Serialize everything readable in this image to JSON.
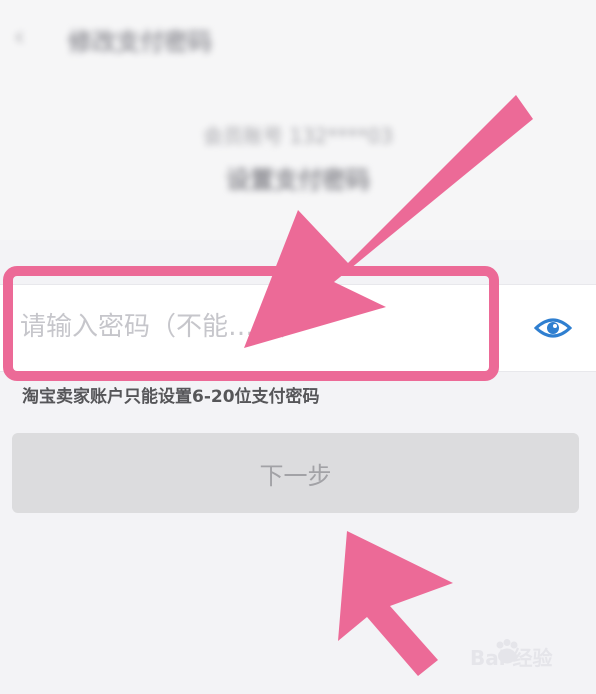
{
  "header": {
    "back_icon": "chevron-left-icon",
    "title": "修改支付密码"
  },
  "intro": {
    "account": "会员账号 132****03",
    "subtitle": "设置支付密码"
  },
  "password": {
    "placeholder": "请输入密码（不能……）",
    "visibility_icon": "eye-icon"
  },
  "hint": "淘宝卖家账户只能设置6-20位支付密码",
  "next_button": {
    "label": "下一步"
  },
  "watermark": {
    "text": "Bai 经验",
    "icon": "paw-icon"
  },
  "colors": {
    "annotation_pink": "#ec6a97",
    "eye_blue": "#2f7fd0",
    "button_bg": "#dcdcde"
  }
}
